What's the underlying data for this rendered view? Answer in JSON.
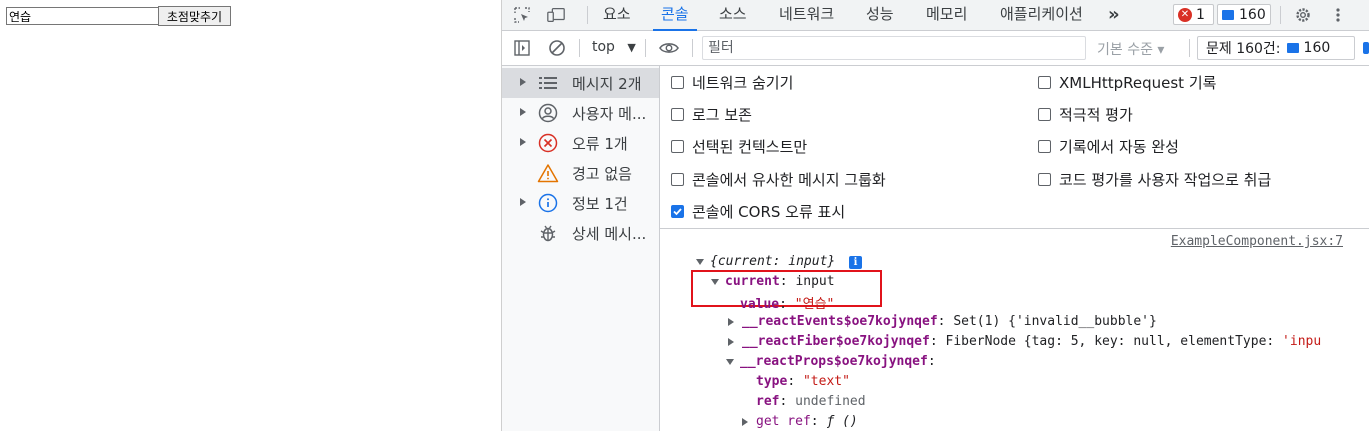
{
  "page": {
    "input_value": "연습",
    "focus_button_label": "초점맞추기"
  },
  "devtools": {
    "tabs": [
      "요소",
      "콘솔",
      "소스",
      "네트워크",
      "성능",
      "메모리",
      "애플리케이션"
    ],
    "active_tab": "콘솔",
    "error_count": "1",
    "issue_count": "160",
    "more_tabs": "»",
    "toolbar": {
      "context": "top",
      "filter_placeholder": "필터",
      "level": "기본 수준 ▾",
      "issues_label": "문제 160건:",
      "issues_count": "160"
    },
    "sidebar": [
      {
        "label": "메시지 2개",
        "icon": "list-icon"
      },
      {
        "label": "사용자 메...",
        "icon": "user-icon"
      },
      {
        "label": "오류 1개",
        "icon": "error-icon"
      },
      {
        "label": "경고 없음",
        "icon": "warning-icon"
      },
      {
        "label": "정보 1건",
        "icon": "info-icon"
      },
      {
        "label": "상세 메시...",
        "icon": "bug-icon"
      }
    ],
    "settings_left": [
      "네트워크 숨기기",
      "로그 보존",
      "선택된 컨텍스트만",
      "콘솔에서 유사한 메시지 그룹화",
      "콘솔에 CORS 오류 표시"
    ],
    "settings_right": [
      "XMLHttpRequest 기록",
      "적극적 평가",
      "기록에서 자동 완성",
      "코드 평가를 사용자 작업으로 취급"
    ],
    "console": {
      "source_link": "ExampleComponent.jsx:7",
      "summary": "{current: input}",
      "current_key": "current",
      "current_val": "input",
      "value_key": "value",
      "value_val": "\"연습\"",
      "events_key": "__reactEvents$oe7kojynqef",
      "events_val": "Set(1) {'invalid__bubble'}",
      "fiber_key": "__reactFiber$oe7kojynqef",
      "fiber_val_pre": "FiberNode {tag: 5, key: null, elementType: ",
      "fiber_val_str": "'inpu",
      "props_key": "__reactProps$oe7kojynqef",
      "type_key": "type",
      "type_val": "\"text\"",
      "ref_key": "ref",
      "ref_val": "undefined",
      "getref_key": "get ref",
      "getref_val": "ƒ ()"
    },
    "colors": {
      "accent": "#1a73e8",
      "error": "#d93025",
      "warning": "#e37400",
      "highlight": "#e1131b"
    }
  }
}
